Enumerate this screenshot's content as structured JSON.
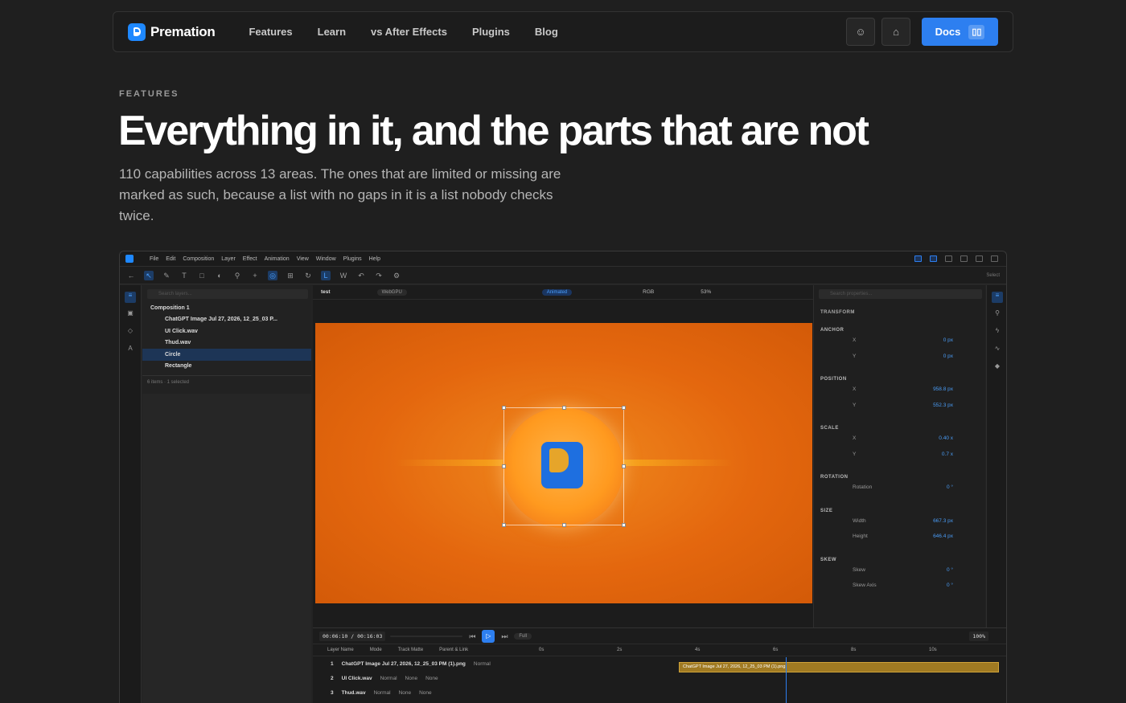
{
  "nav": {
    "brand": "Premation",
    "links": [
      "Features",
      "Learn",
      "vs After Effects",
      "Plugins",
      "Blog"
    ],
    "docs_label": "Docs"
  },
  "hero": {
    "eyebrow": "FEATURES",
    "title": "Everything in it, and the parts that are not",
    "subtitle": "110 capabilities across 13 areas. The ones that are limited or missing are marked as such, because a list with no gaps in it is a list nobody checks twice."
  },
  "app": {
    "menus": [
      "File",
      "Edit",
      "Composition",
      "Layer",
      "Effect",
      "Animation",
      "View",
      "Window",
      "Plugins",
      "Help"
    ],
    "select_label": "Select",
    "layers": {
      "search_placeholder": "Search layers...",
      "items": [
        "Composition 1",
        "ChatGPT Image Jul 27, 2026, 12_25_03 P...",
        "UI Click.wav",
        "Thud.wav",
        "Circle",
        "Rectangle"
      ],
      "footer": "6 items · 1 selected"
    },
    "viewer": {
      "tab": "test",
      "renderer": "WebGPU",
      "mode": "Animated",
      "channel": "RGB",
      "zoom": "53%"
    },
    "properties": {
      "search_placeholder": "Search properties...",
      "section": "TRANSFORM",
      "groups": [
        {
          "name": "ANCHOR",
          "rows": [
            {
              "label": "X",
              "value": "0 px"
            },
            {
              "label": "Y",
              "value": "0 px"
            }
          ]
        },
        {
          "name": "POSITION",
          "rows": [
            {
              "label": "X",
              "value": "958.8 px"
            },
            {
              "label": "Y",
              "value": "552.3 px"
            }
          ]
        },
        {
          "name": "SCALE",
          "rows": [
            {
              "label": "X",
              "value": "0.40 x"
            },
            {
              "label": "Y",
              "value": "0.7 x"
            }
          ]
        },
        {
          "name": "ROTATION",
          "rows": [
            {
              "label": "Rotation",
              "value": "0 °"
            }
          ]
        },
        {
          "name": "SIZE",
          "rows": [
            {
              "label": "Width",
              "value": "667.3 px"
            },
            {
              "label": "Height",
              "value": "646.4 px"
            }
          ]
        },
        {
          "name": "SKEW",
          "rows": [
            {
              "label": "Skew",
              "value": "0 °"
            },
            {
              "label": "Skew Axis",
              "value": "0 °"
            }
          ]
        }
      ]
    },
    "timeline": {
      "current": "00:06:10",
      "total": "00:16:03",
      "quality": "Full",
      "zoom": "100%",
      "columns": [
        "Layer Name",
        "Mode",
        "Track Matte",
        "Parent & Link"
      ],
      "ruler": [
        "0s",
        "2s",
        "4s",
        "6s",
        "8s",
        "10s"
      ],
      "rows": [
        {
          "num": "1",
          "name": "ChatGPT Image Jul 27, 2026, 12_25_03 PM (1).png",
          "mode": "Normal"
        },
        {
          "num": "2",
          "name": "UI Click.wav",
          "mode": "Normal",
          "matte": "None",
          "parent": "None"
        },
        {
          "num": "3",
          "name": "Thud.wav",
          "mode": "Normal",
          "matte": "None",
          "parent": "None"
        }
      ],
      "clip_label": "ChatGPT Image Jul 27, 2026, 12_25_03 PM (1).png"
    }
  }
}
